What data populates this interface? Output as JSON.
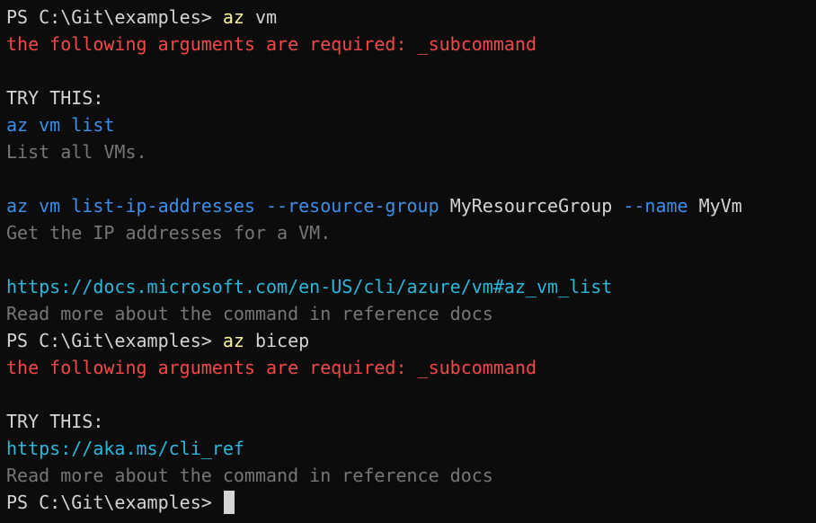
{
  "colors": {
    "background": "#0c0c0c",
    "default": "#d4d4d4",
    "command": "#f9f1a5",
    "error": "#f04848",
    "suggestion": "#3b8eea",
    "description": "#767676",
    "link": "#29b8db"
  },
  "terminal": {
    "prompt": "PS C:\\Git\\examples> ",
    "blocks": [
      {
        "command_exe": "az",
        "command_args": " vm",
        "error": "the following arguments are required: _subcommand",
        "try_this_label": "TRY THIS:",
        "suggestion1": {
          "command": "az vm list",
          "description": "List all VMs."
        },
        "suggestion2": {
          "part1": "az vm list-ip-addresses --resource-group ",
          "value1": "MyResourceGroup",
          "part2": " --name ",
          "value2": "MyVm",
          "description": "Get the IP addresses for a VM."
        },
        "link": "https://docs.microsoft.com/en-US/cli/azure/vm#az_vm_list",
        "link_description": "Read more about the command in reference docs"
      },
      {
        "command_exe": "az",
        "command_args": " bicep",
        "error": "the following arguments are required: _subcommand",
        "try_this_label": "TRY THIS:",
        "link": "https://aka.ms/cli_ref",
        "link_description": "Read more about the command in reference docs"
      }
    ]
  }
}
